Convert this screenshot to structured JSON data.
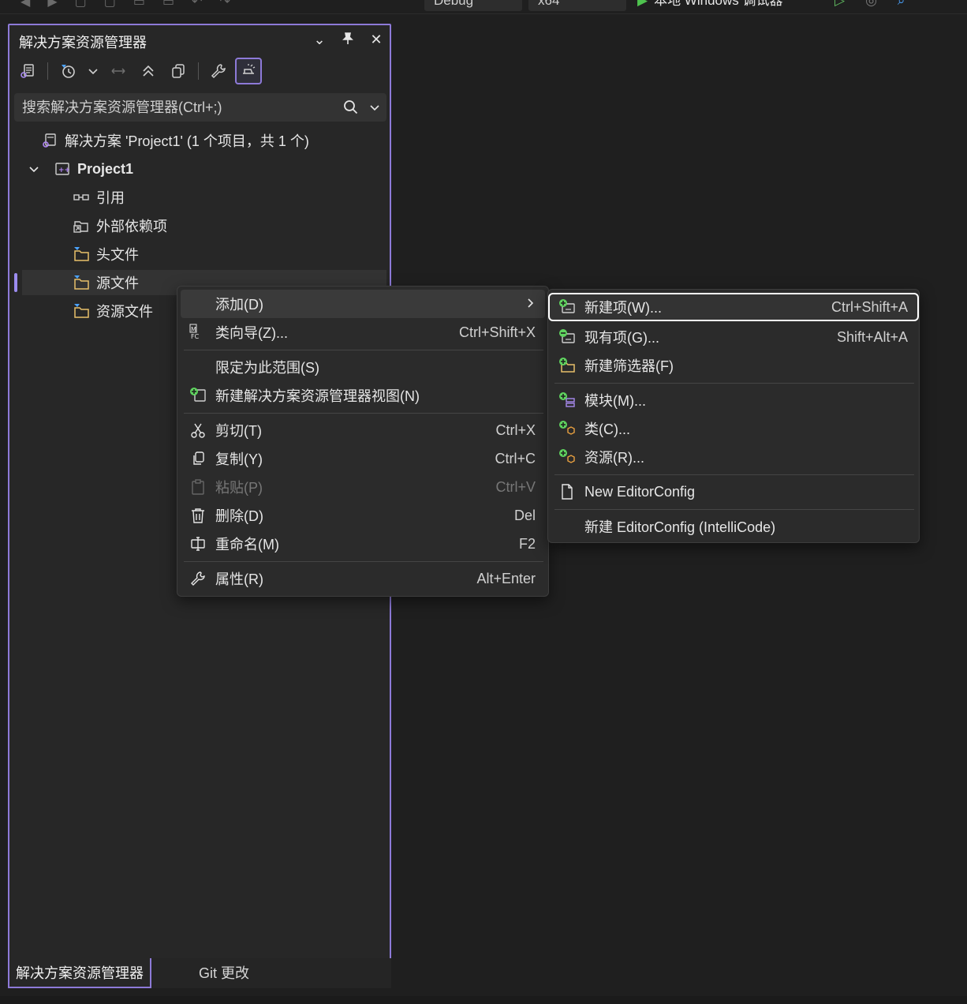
{
  "topbar": {
    "config_combo": "Debug",
    "platform_combo": "x64",
    "run_label": "本地 Windows 调试器"
  },
  "panel": {
    "title": "解决方案资源管理器",
    "search_placeholder": "搜索解决方案资源管理器(Ctrl+;)"
  },
  "tree": {
    "solution": "解决方案 'Project1' (1 个项目，共 1 个)",
    "project": "Project1",
    "references": "引用",
    "external_deps": "外部依赖项",
    "header_files": "头文件",
    "source_files": "源文件",
    "resource_files": "资源文件"
  },
  "tabs": {
    "active": "解决方案资源管理器",
    "inactive": "Git 更改"
  },
  "context_menu": {
    "add": {
      "label": "添加(D)"
    },
    "class_wizard": {
      "label": "类向导(Z)...",
      "shortcut": "Ctrl+Shift+X"
    },
    "scope": {
      "label": "限定为此范围(S)"
    },
    "new_view": {
      "label": "新建解决方案资源管理器视图(N)"
    },
    "cut": {
      "label": "剪切(T)",
      "shortcut": "Ctrl+X"
    },
    "copy": {
      "label": "复制(Y)",
      "shortcut": "Ctrl+C"
    },
    "paste": {
      "label": "粘贴(P)",
      "shortcut": "Ctrl+V"
    },
    "delete": {
      "label": "删除(D)",
      "shortcut": "Del"
    },
    "rename": {
      "label": "重命名(M)",
      "shortcut": "F2"
    },
    "properties": {
      "label": "属性(R)",
      "shortcut": "Alt+Enter"
    }
  },
  "submenu": {
    "new_item": {
      "label": "新建项(W)...",
      "shortcut": "Ctrl+Shift+A"
    },
    "existing_item": {
      "label": "现有项(G)...",
      "shortcut": "Shift+Alt+A"
    },
    "new_filter": {
      "label": "新建筛选器(F)"
    },
    "module": {
      "label": "模块(M)..."
    },
    "class": {
      "label": "类(C)..."
    },
    "resource": {
      "label": "资源(R)..."
    },
    "editorconfig": {
      "label": "New EditorConfig"
    },
    "editorconfig_ic": {
      "label": "新建 EditorConfig (IntelliCode)"
    }
  },
  "colors": {
    "accent": "#8d7ad8",
    "add_badge": "#5fd35f",
    "folder": "#e8c06a"
  }
}
